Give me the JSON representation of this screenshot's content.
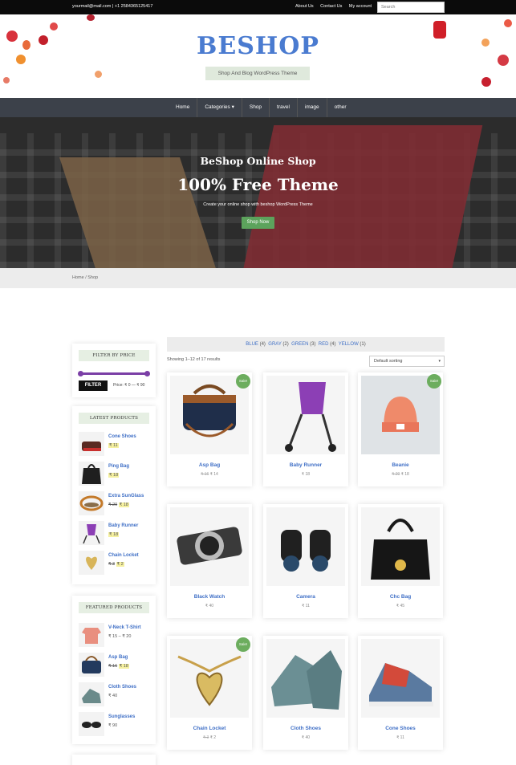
{
  "topbar": {
    "contact": "yourmail@mail.com | +1 2584365125417",
    "links": [
      "About Us",
      "Contact Us",
      "My account"
    ],
    "search_placeholder": "Search"
  },
  "header": {
    "logo": "BESHOP",
    "tagline": "Shop And Blog WordPress Theme"
  },
  "nav": {
    "items": [
      "Home",
      "Categories",
      "Shop",
      "travel",
      "image",
      "other"
    ],
    "dropdown_caret": "▾"
  },
  "hero": {
    "subtitle": "BeShop Online Shop",
    "title": "100% Free Theme",
    "description": "Create your online shop with beshop WordPress Theme",
    "button": "Shop Now"
  },
  "breadcrumb": "Home / Shop",
  "sidebar": {
    "price_widget": {
      "title": "FILTER BY PRICE",
      "button": "FILTER",
      "price_text": "Price: ₹ 0 — ₹ 90"
    },
    "latest": {
      "title": "LATEST PRODUCTS",
      "items": [
        {
          "name": "Cone Shoes",
          "old": "",
          "price": "₹ 11"
        },
        {
          "name": "Ping Bag",
          "old": "",
          "price": "₹ 18"
        },
        {
          "name": "Extra SunGlass",
          "old": "₹ 20",
          "price": "₹ 18"
        },
        {
          "name": "Baby Runner",
          "old": "",
          "price": "₹ 18"
        },
        {
          "name": "Chain Locket",
          "old": "₹ 3",
          "price": "₹ 2"
        }
      ]
    },
    "featured": {
      "title": "FEATURED PRODUCTS",
      "items": [
        {
          "name": "V-Neck T-Shirt",
          "old": "",
          "price": "₹ 15 – ₹ 20"
        },
        {
          "name": "Asp Bag",
          "old": "₹ 16",
          "price": "₹ 18"
        },
        {
          "name": "Cloth Shoes",
          "old": "",
          "price": "₹ 40"
        },
        {
          "name": "Sunglasses",
          "old": "",
          "price": "₹ 90"
        }
      ]
    }
  },
  "shop": {
    "filters": [
      {
        "label": "BLUE",
        "count": "(4)"
      },
      {
        "label": "GRAY",
        "count": "(2)"
      },
      {
        "label": "GREEN",
        "count": "(3)"
      },
      {
        "label": "RED",
        "count": "(4)"
      },
      {
        "label": "YELLOW",
        "count": "(1)"
      }
    ],
    "showing": "Showing 1–12 of 17 results",
    "sorting": "Default sorting",
    "products": [
      {
        "name": "Asp Bag",
        "old": "₹ 16",
        "price": "₹ 14",
        "sale": "Sale!"
      },
      {
        "name": "Baby Runner",
        "old": "",
        "price": "₹ 18",
        "sale": ""
      },
      {
        "name": "Beanie",
        "old": "₹ 20",
        "price": "₹ 18",
        "sale": "Sale!"
      },
      {
        "name": "Black Watch",
        "old": "",
        "price": "₹ 40",
        "sale": ""
      },
      {
        "name": "Camera",
        "old": "",
        "price": "₹ 11",
        "sale": ""
      },
      {
        "name": "Chc Bag",
        "old": "",
        "price": "₹ 45",
        "sale": ""
      },
      {
        "name": "Chain Locket",
        "old": "₹ 3",
        "price": "₹ 2",
        "sale": "Sale!"
      },
      {
        "name": "Cloth Shoes",
        "old": "",
        "price": "₹ 40",
        "sale": ""
      },
      {
        "name": "Cone Shoes",
        "old": "",
        "price": "₹ 11",
        "sale": ""
      }
    ]
  },
  "colors": {
    "accent": "#4a7bd0",
    "link": "#3f6fc6",
    "nav": "#3c414a",
    "sale": "#6cad5e",
    "button_green": "#5ca35c",
    "slider": "#7b3fa6"
  }
}
